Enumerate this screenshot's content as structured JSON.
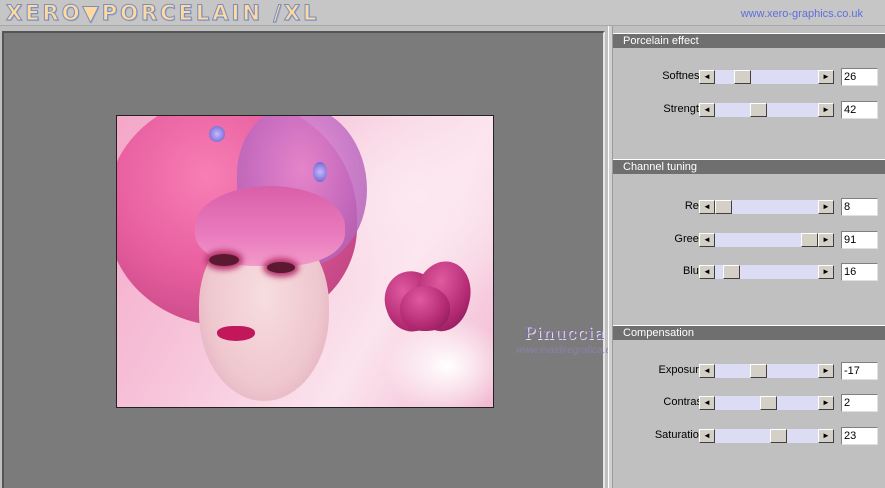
{
  "header": {
    "logo_text": "XERO▼PORCELAIN /XL",
    "site_url": "www.xero-graphics.co.uk"
  },
  "preview": {
    "watermark": "Pinuccia",
    "watermark_url": "www.maidiregrafica.eu"
  },
  "groups": [
    {
      "title": "Porcelain effect",
      "params": [
        {
          "label": "Softness",
          "value": "26",
          "fraction": 0.26
        },
        {
          "label": "Strength",
          "value": "42",
          "fraction": 0.42
        }
      ]
    },
    {
      "title": "Channel tuning",
      "params": [
        {
          "label": "Red",
          "value": "8",
          "fraction": 0.08
        },
        {
          "label": "Green",
          "value": "91",
          "fraction": 0.91
        },
        {
          "label": "Blue",
          "value": "16",
          "fraction": 0.16
        }
      ]
    },
    {
      "title": "Compensation",
      "params": [
        {
          "label": "Exposure",
          "value": "-17",
          "fraction": 0.415
        },
        {
          "label": "Contrast",
          "value": "2",
          "fraction": 0.51
        },
        {
          "label": "Saturation",
          "value": "23",
          "fraction": 0.615
        }
      ]
    }
  ],
  "icons": {
    "arrow_left": "◄",
    "arrow_right": "►"
  }
}
